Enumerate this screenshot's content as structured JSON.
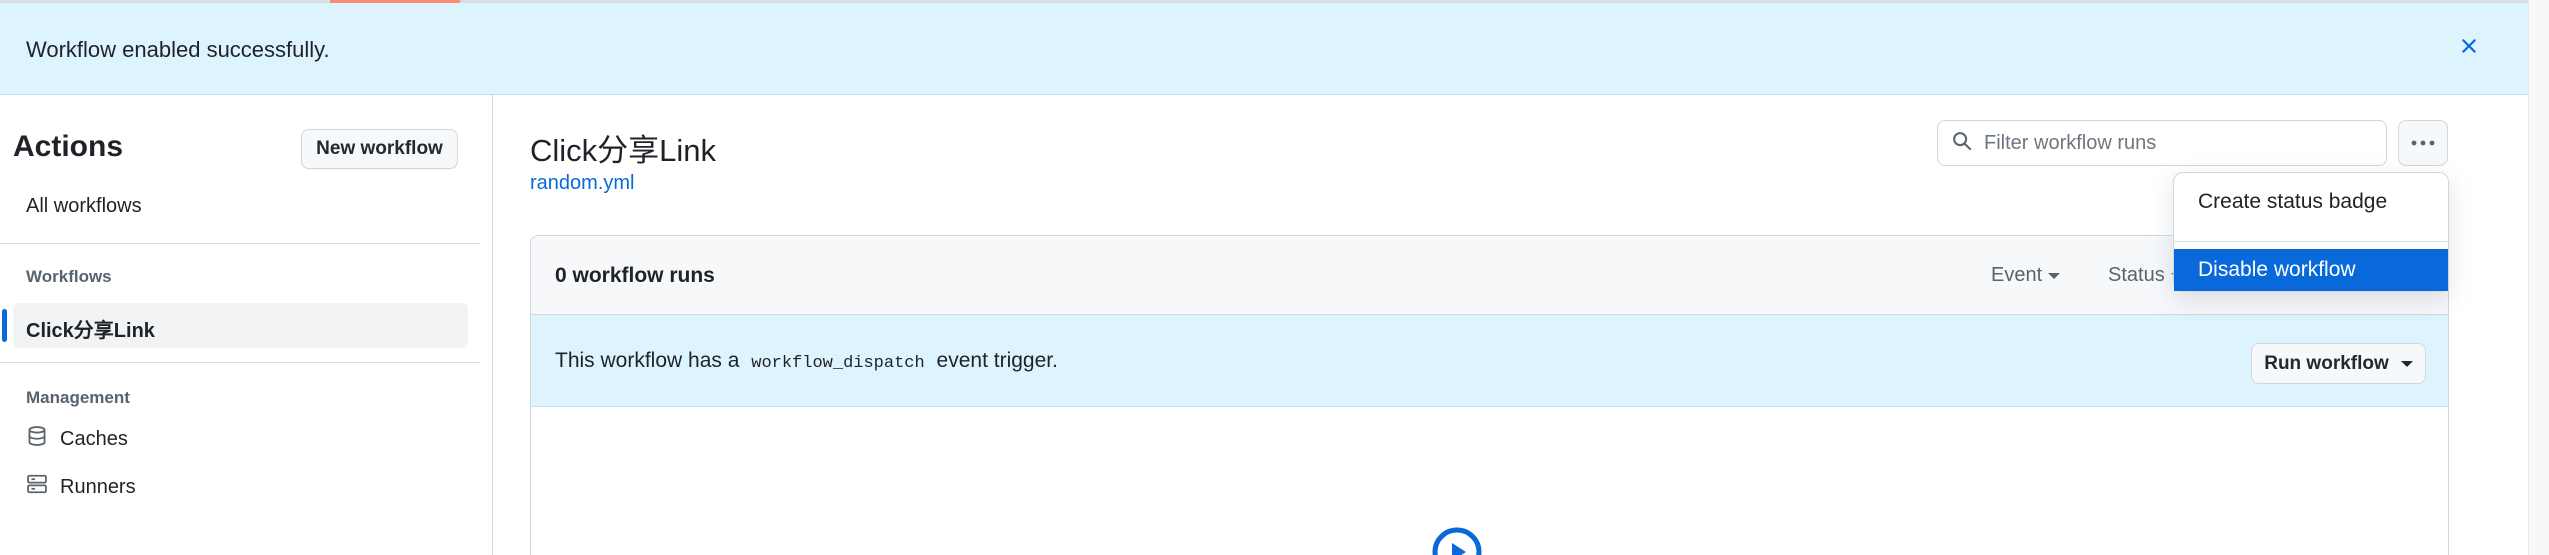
{
  "flash": {
    "message": "Workflow enabled successfully."
  },
  "sidebar": {
    "title": "Actions",
    "new_workflow_label": "New workflow",
    "all_workflows_label": "All workflows",
    "workflows_heading": "Workflows",
    "active_workflow": "Click分享Link",
    "management_heading": "Management",
    "management_items": [
      {
        "label": "Caches",
        "icon": "database-icon"
      },
      {
        "label": "Runners",
        "icon": "server-icon"
      }
    ]
  },
  "header": {
    "title": "Click分享Link",
    "file": "random.yml",
    "search_placeholder": "Filter workflow runs"
  },
  "runs": {
    "count_label": "0 workflow runs",
    "filters": [
      "Event",
      "Status"
    ]
  },
  "dispatch": {
    "text_before": "This workflow has a",
    "code": "workflow_dispatch",
    "text_after": "event trigger.",
    "run_button_label": "Run workflow"
  },
  "menu": {
    "items": [
      "Create status badge",
      "Disable workflow"
    ],
    "highlighted": "Disable workflow"
  },
  "colors": {
    "accent": "#0969da",
    "flash_bg": "#ddf4ff",
    "border": "#d0d7de"
  }
}
